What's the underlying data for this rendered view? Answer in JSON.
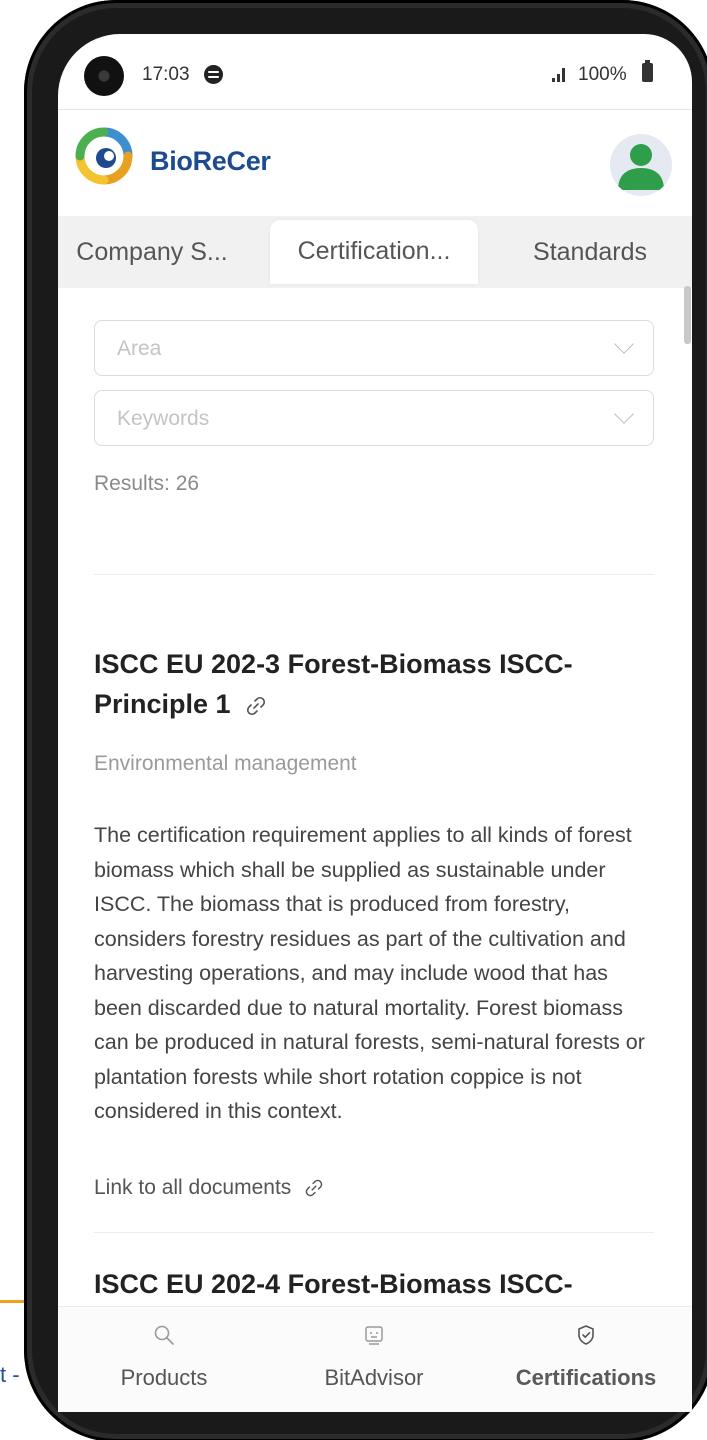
{
  "background": {
    "partial_text": "t -"
  },
  "status_bar": {
    "time": "17:03",
    "battery": "100%"
  },
  "header": {
    "brand": "BioReCer"
  },
  "tabs": [
    {
      "label": "Company S..."
    },
    {
      "label": "Certification..."
    },
    {
      "label": "Standards"
    }
  ],
  "filters": {
    "area_placeholder": "Area",
    "keywords_placeholder": "Keywords",
    "results": "Results: 26"
  },
  "certifications": [
    {
      "title_line1": "ISCC EU 202-3 Forest-Biomass ISCC-",
      "title_line2": "Principle 1",
      "area": "Environmental management",
      "description": "The certification requirement applies to all kinds of forest biomass which shall be supplied as sustainable under ISCC. The biomass that is produced from forestry, considers forestry residues as part of the cultivation and harvesting operations, and may include wood that has been discarded due to natural mortality. Forest biomass can be produced in natural forests, semi-natural forests or plantation forests while short rotation coppice is not considered in this context.",
      "docs_link": "Link to all documents"
    },
    {
      "title_line1": "ISCC EU 202-4 Forest-Biomass ISCC-"
    }
  ],
  "bottom_nav": [
    {
      "label": "Products",
      "icon": "search-icon"
    },
    {
      "label": "BitAdvisor",
      "icon": "robot-icon"
    },
    {
      "label": "Certifications",
      "icon": "shield-check-icon"
    }
  ],
  "colors": {
    "brand": "#1d4b8f",
    "avatar": "#2e9e4b",
    "accent_orange": "#f0a020"
  }
}
